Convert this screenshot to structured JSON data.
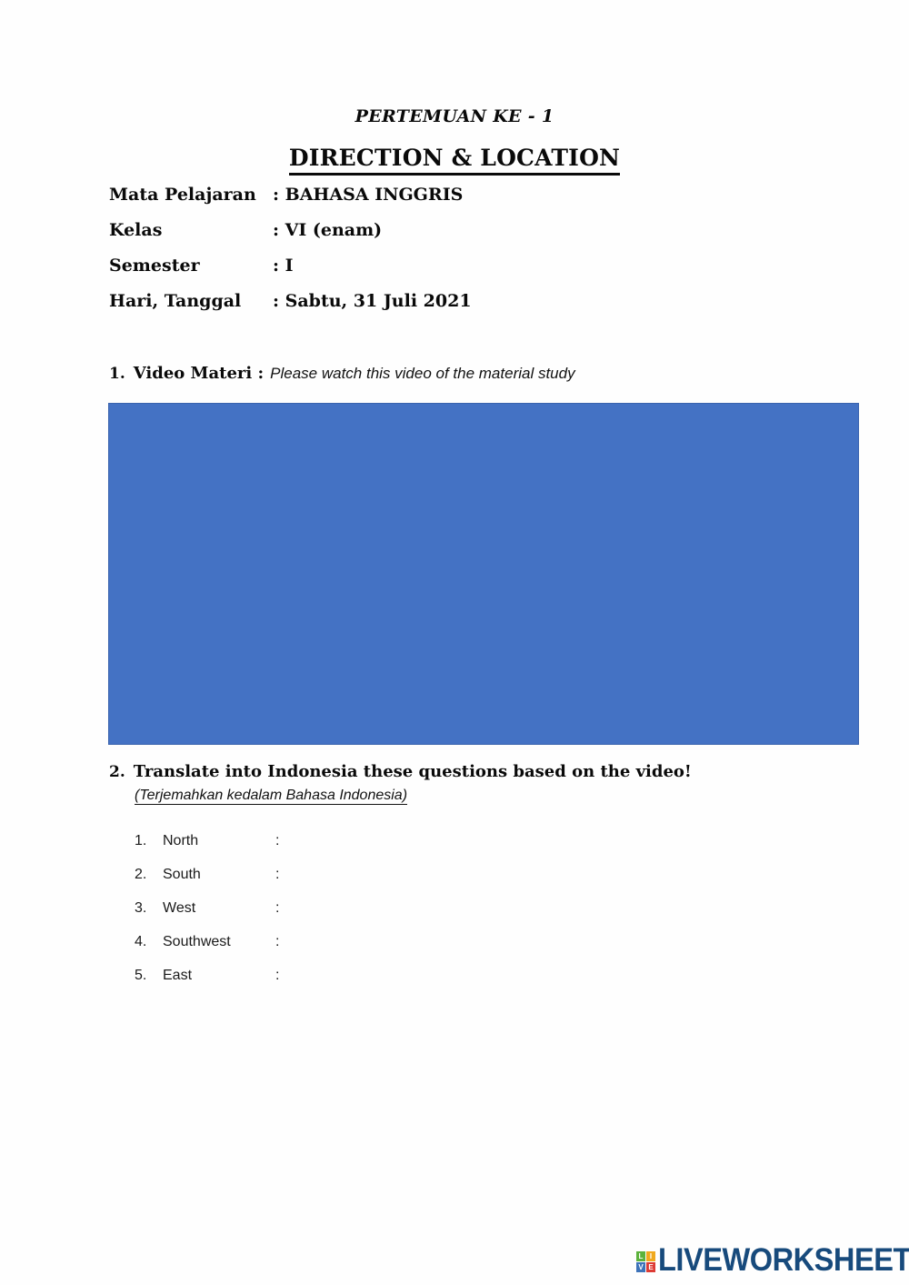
{
  "document": {
    "meeting_title": "PERTEMUAN KE - 1",
    "main_title": "DIRECTION & LOCATION",
    "meta": [
      {
        "label": "Mata Pelajaran",
        "value": ": BAHASA INGGRIS"
      },
      {
        "label": "Kelas",
        "value": ": VI (enam)"
      },
      {
        "label": "Semester",
        "value": ": I"
      },
      {
        "label": "Hari, Tanggal",
        "value": ": Sabtu, 31 Juli 2021"
      }
    ]
  },
  "section1": {
    "number": "1.",
    "heading": "Video Materi :",
    "instruction": "Please watch this video of the material study",
    "video_placeholder_color": "#4472C4"
  },
  "section2": {
    "number": "2.",
    "heading": "Translate into Indonesia these questions based on the video!",
    "subheading": "(Terjemahkan kedalam Bahasa Indonesia)",
    "questions": [
      {
        "num": "1.",
        "text": "North",
        "colon": ":"
      },
      {
        "num": "2.",
        "text": "South",
        "colon": ":"
      },
      {
        "num": "3.",
        "text": "West",
        "colon": ":"
      },
      {
        "num": "4.",
        "text": "Southwest",
        "colon": ":"
      },
      {
        "num": "5.",
        "text": "East",
        "colon": ":"
      }
    ]
  },
  "footer": {
    "logo_tiles": [
      {
        "letter": "L",
        "color": "#5CB23C"
      },
      {
        "letter": "I",
        "color": "#F0A91E"
      },
      {
        "letter": "V",
        "color": "#3E73B9"
      },
      {
        "letter": "E",
        "color": "#DD3B34"
      }
    ],
    "wordmark": "LIVEWORKSHEETS",
    "wordmark_color": "#174A7C"
  }
}
